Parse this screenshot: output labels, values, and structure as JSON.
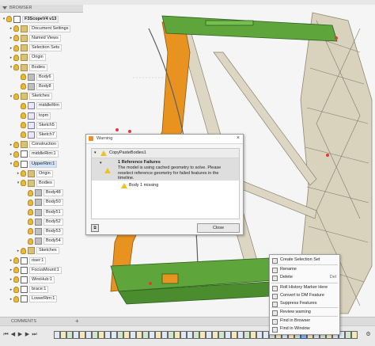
{
  "browser": {
    "title": "BROWSER",
    "items": [
      {
        "label": "F3ScopeV4 v13",
        "indent": 0,
        "type": "comp",
        "root": true,
        "arrow": "▾"
      },
      {
        "label": "Document Settings",
        "indent": 1,
        "type": "folder",
        "arrow": "▸"
      },
      {
        "label": "Named Views",
        "indent": 1,
        "type": "folder",
        "arrow": "▸"
      },
      {
        "label": "Selection Sets",
        "indent": 1,
        "type": "folder",
        "arrow": "▸"
      },
      {
        "label": "Origin",
        "indent": 1,
        "type": "folder",
        "arrow": "▸"
      },
      {
        "label": "Bodies",
        "indent": 1,
        "type": "folder",
        "arrow": "▾"
      },
      {
        "label": "Body6",
        "indent": 2,
        "type": "body"
      },
      {
        "label": "Body8",
        "indent": 2,
        "type": "body"
      },
      {
        "label": "Sketches",
        "indent": 1,
        "type": "folder",
        "arrow": "▾"
      },
      {
        "label": "middleRim",
        "indent": 2,
        "type": "sketch"
      },
      {
        "label": "topm",
        "indent": 2,
        "type": "sketch"
      },
      {
        "label": "Sketch5",
        "indent": 2,
        "type": "sketch"
      },
      {
        "label": "Sketch7",
        "indent": 2,
        "type": "sketch"
      },
      {
        "label": "Construction",
        "indent": 1,
        "type": "folder",
        "arrow": "▸"
      },
      {
        "label": "middleRim:1",
        "indent": 1,
        "type": "comp",
        "arrow": "▸"
      },
      {
        "label": "UpperRim:1",
        "indent": 1,
        "type": "comp",
        "arrow": "▾",
        "selected": true
      },
      {
        "label": "Origin",
        "indent": 2,
        "type": "folder",
        "arrow": "▸"
      },
      {
        "label": "Bodies",
        "indent": 2,
        "type": "folder",
        "arrow": "▾"
      },
      {
        "label": "Body48",
        "indent": 3,
        "type": "body"
      },
      {
        "label": "Body50",
        "indent": 3,
        "type": "body"
      },
      {
        "label": "Body51",
        "indent": 3,
        "type": "body"
      },
      {
        "label": "Body52",
        "indent": 3,
        "type": "body"
      },
      {
        "label": "Body53",
        "indent": 3,
        "type": "body"
      },
      {
        "label": "Body54",
        "indent": 3,
        "type": "body"
      },
      {
        "label": "Sketches",
        "indent": 2,
        "type": "folder",
        "arrow": "▸"
      },
      {
        "label": "riser:1",
        "indent": 1,
        "type": "comp",
        "arrow": "▸"
      },
      {
        "label": "FocusMount:1",
        "indent": 1,
        "type": "comp",
        "arrow": "▸"
      },
      {
        "label": "WireHub:1",
        "indent": 1,
        "type": "comp",
        "arrow": "▸"
      },
      {
        "label": "brace:1",
        "indent": 1,
        "type": "comp",
        "arrow": "▸"
      },
      {
        "label": "LowerRim:1",
        "indent": 1,
        "type": "comp",
        "arrow": "▸"
      }
    ]
  },
  "comments": {
    "label": "COMMENTS"
  },
  "warning": {
    "title": "Warning",
    "feature": "CopyPasteBodies1",
    "heading": "1 Reference Failures",
    "message": "The model is using cached geometry to solve. Please reselect reference geometry for failed features in the timeline.",
    "missing": "Body 1 missing",
    "close_label": "Close"
  },
  "context_menu": {
    "items": [
      {
        "label": "Create Selection Set",
        "shortcut": ""
      },
      {
        "label": "Rename",
        "shortcut": ""
      },
      {
        "label": "Delete",
        "shortcut": "Del"
      },
      {
        "label": "Roll History Marker Here",
        "shortcut": ""
      },
      {
        "label": "Convert to DM Feature",
        "shortcut": ""
      },
      {
        "label": "Suppress Features",
        "shortcut": ""
      },
      {
        "label": "Review warning",
        "shortcut": ""
      },
      {
        "label": "Find in Browser",
        "shortcut": ""
      },
      {
        "label": "Find in Window",
        "shortcut": ""
      }
    ]
  },
  "colors": {
    "green_part": "#5ea63c",
    "orange_part": "#e8921f",
    "wood_frame": "#d8cfb6",
    "warning_yellow": "#f0c020"
  }
}
